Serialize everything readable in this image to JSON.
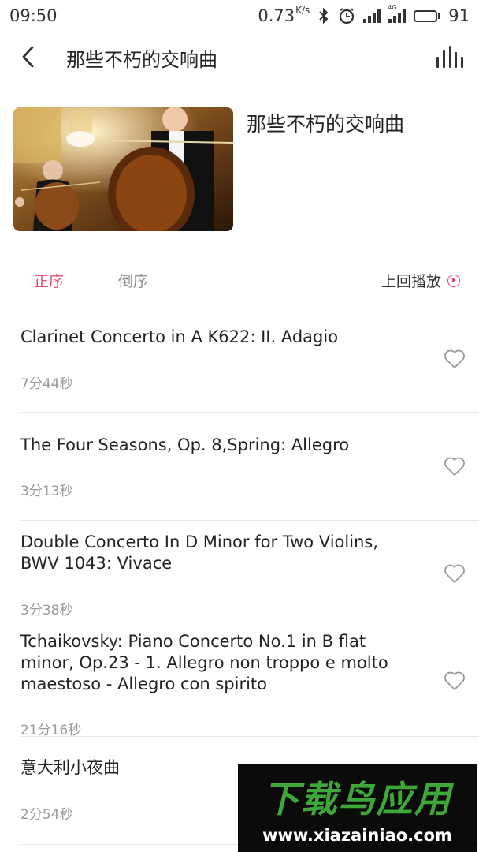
{
  "status_bar": {
    "time": "09:50",
    "speed_value": "0.73",
    "speed_unit": "K/s",
    "battery_level": "91",
    "network_label": "4G"
  },
  "header": {
    "title": "那些不朽的交响曲"
  },
  "album": {
    "title": "那些不朽的交响曲"
  },
  "sort": {
    "ascending": "正序",
    "descending": "倒序",
    "resume_label": "上回播放"
  },
  "tracks": [
    {
      "title": "Clarinet Concerto in A K622: II. Adagio",
      "duration": "7分44秒"
    },
    {
      "title": "The Four Seasons, Op. 8,Spring: Allegro",
      "duration": "3分13秒"
    },
    {
      "title": "Double Concerto In D Minor for Two Violins, BWV 1043: Vivace",
      "duration": "3分38秒"
    },
    {
      "title": "Tchaikovsky: Piano Concerto No.1 in B flat minor, Op.23 - 1. Allegro non troppo e molto maestoso - Allegro con spirito",
      "duration": "21分16秒"
    },
    {
      "title": "意大利小夜曲",
      "duration": "2分54秒"
    }
  ],
  "watermark": {
    "logo_text": "下载鸟应用",
    "url": "www.xiazainiao.com"
  },
  "colors": {
    "accent": "#e0486f",
    "text_primary": "#222222",
    "text_secondary": "#9a9a9a",
    "divider": "#e6e6e6"
  }
}
